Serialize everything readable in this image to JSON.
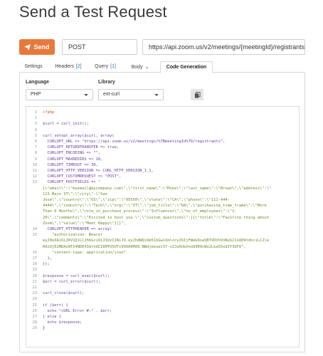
{
  "page": {
    "title": "Send a Test Request"
  },
  "request": {
    "send_label": "Send",
    "method": "POST",
    "url": "https://api.zoom.us/v2/meetings/{meetingId}/registrants"
  },
  "tabs": [
    {
      "label": "Settings",
      "count": ""
    },
    {
      "label": "Headers",
      "count": "[2]"
    },
    {
      "label": "Query",
      "count": "[1]"
    },
    {
      "label": "Body",
      "count": ""
    },
    {
      "label": "Code Generation",
      "count": ""
    }
  ],
  "active_tab": "Code Generation",
  "codegen": {
    "language_label": "Language",
    "language_value": "PHP",
    "library_label": "Library",
    "library_value": "ext-curl"
  },
  "code_lines": [
    {
      "n": "1",
      "text": "<?php",
      "kind": "kw"
    },
    {
      "n": "2",
      "text": "",
      "kind": ""
    },
    {
      "n": "3",
      "text": "$curl = curl_init();",
      "kind": "var"
    },
    {
      "n": "4",
      "text": "",
      "kind": ""
    },
    {
      "n": "5",
      "text": "curl_setopt_array($curl, array(",
      "kind": "var"
    },
    {
      "n": "6",
      "text": "  CURLOPT_URL => \"https://api.zoom.us/v2/meetings/%7BmeetingId%7D/registrants\",",
      "kind": "var"
    },
    {
      "n": "7",
      "text": "  CURLOPT_RETURNTRANSFER => true,",
      "kind": "var"
    },
    {
      "n": "8",
      "text": "  CURLOPT_ENCODING => \"\",",
      "kind": "var"
    },
    {
      "n": "9",
      "text": "  CURLOPT_MAXREDIRS => 10,",
      "kind": "var"
    },
    {
      "n": "10",
      "text": "  CURLOPT_TIMEOUT => 30,",
      "kind": "var"
    },
    {
      "n": "11",
      "text": "  CURLOPT_HTTP_VERSION => CURL_HTTP_VERSION_1_1,",
      "kind": "var"
    },
    {
      "n": "12",
      "text": "  CURLOPT_CUSTOMREQUEST => \"POST\",",
      "kind": "var"
    },
    {
      "n": "13",
      "text": "  CURLOPT_POSTFIELDS => \"",
      "kind": "var"
    },
    {
      "n": "",
      "text": "{\\\"email\\\":\\\"myemail@mycompany.com\\\",\\\"first_name\\\":\\\"Mike\\\",\\\"last_name\\\":\\\"Brown\\\",\\\"address\\\":\\\"",
      "kind": "str"
    },
    {
      "n": "",
      "text": "123 Main ST\\\",\\\"city\\\":\\\"San",
      "kind": "str"
    },
    {
      "n": "",
      "text": "Jose\\\",\\\"country\\\":\\\"US\\\",\\\"zip\\\":\\\"95550\\\",\\\"state\\\":\\\"CA\\\",\\\"phone\\\":\\\"111-444-",
      "kind": "str"
    },
    {
      "n": "",
      "text": "4444\\\",\\\"industry\\\":\\\"Tech\\\",\\\"org\\\":\\\"IT\\\",\\\"job_title\\\":\\\"DA\\\",\\\"purchasing_time_frame\\\":\\\"More",
      "kind": "str"
    },
    {
      "n": "",
      "text": "Than 6 Months\\\",\\\"role_in_purchase_process\\\":\\\"Influencer\\\",\\\"no_of_employees\\\":\\\"1-",
      "kind": "str"
    },
    {
      "n": "",
      "text": "20\\\",\\\"comments\\\":\\\"Excited to host you.\\\",\\\"custom_questions\\\":[{\\\"title\\\":\\\"Favorite thing about",
      "kind": "str"
    },
    {
      "n": "",
      "text": "Zoom\\\",\\\"value\\\":\\\"Meet Happy\\\"}]}\",",
      "kind": "str"
    },
    {
      "n": "14",
      "text": "  CURLOPT_HTTPHEADER => array(",
      "kind": "var"
    },
    {
      "n": "15",
      "text": "    \"authorization: Bearer",
      "kind": "str"
    },
    {
      "n": "",
      "text": "eyJ0eXAiOiJKV1QiLCJhbGciOiJIUzI1NiJ9.eyJhdWQiOm51bGwsImlzcyI6IjFWeG9oaSBTVDVhVnNuS21oQ09tdnciLCJle",
      "kind": "str"
    },
    {
      "n": "",
      "text": "HAiOjE2MDAxNTI4NDE4ImlhdCI6MTU5OTc0OOA0MX0.NWdjmxuev37-vZJu6UeXnoQ9R9cWo2Lka5XxdIY3bFQ\",",
      "kind": "str"
    },
    {
      "n": "16",
      "text": "    \"content-type: application/json\"",
      "kind": "str"
    },
    {
      "n": "17",
      "text": "  ),",
      "kind": ""
    },
    {
      "n": "18",
      "text": "));",
      "kind": ""
    },
    {
      "n": "19",
      "text": "",
      "kind": ""
    },
    {
      "n": "20",
      "text": "$response = curl_exec($curl);",
      "kind": "var"
    },
    {
      "n": "21",
      "text": "$err = curl_error($curl);",
      "kind": "var"
    },
    {
      "n": "22",
      "text": "",
      "kind": ""
    },
    {
      "n": "23",
      "text": "curl_close($curl);",
      "kind": "var"
    },
    {
      "n": "24",
      "text": "",
      "kind": ""
    },
    {
      "n": "25",
      "text": "if ($err) {",
      "kind": "var"
    },
    {
      "n": "26",
      "text": "  echo \"cURL Error #:\" . $err;",
      "kind": "var"
    },
    {
      "n": "27",
      "text": "} else {",
      "kind": "var"
    },
    {
      "n": "28",
      "text": "  echo $response;",
      "kind": "var"
    },
    {
      "n": "29",
      "text": "}",
      "kind": ""
    }
  ],
  "colors": {
    "send_button": "#e8793a",
    "count_badge": "#2f6fb3",
    "keyword": "#d6491f",
    "string": "#6a8a2a",
    "variable": "#6b3fa0"
  },
  "icons": {
    "send": "paper-plane-icon",
    "copy": "copy-icon",
    "caret": "chevron-down-icon"
  }
}
